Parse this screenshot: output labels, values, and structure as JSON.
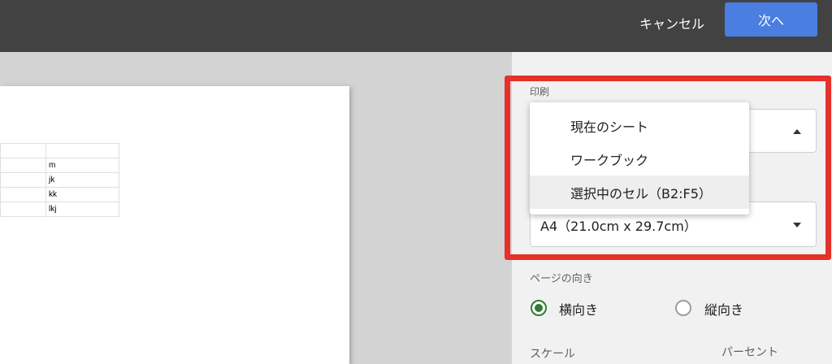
{
  "header": {
    "cancel_label": "キャンセル",
    "next_label": "次へ",
    "colors": {
      "bar": "#424242",
      "next": "#4a7ee0"
    }
  },
  "preview": {
    "rows": [
      [
        "",
        ""
      ],
      [
        "",
        "m"
      ],
      [
        "",
        "jk"
      ],
      [
        "",
        "kk"
      ],
      [
        "",
        "lkj"
      ]
    ]
  },
  "settings": {
    "print_label": "印刷",
    "print_options": [
      "現在のシート",
      "ワークブック",
      "選択中のセル（B2:F5）"
    ],
    "print_highlighted": "選択中のセル（B2:F5）",
    "paper_size_value": "A4（21.0cm x 29.7cm）",
    "orientation_label": "ページの向き",
    "landscape_label": "横向き",
    "portrait_label": "縦向き",
    "orientation_selected": "横向き",
    "scale_label": "スケール",
    "percent_label": "パーセント",
    "highlight_color": "#e6302b",
    "radio_color": "#2e7d32"
  }
}
